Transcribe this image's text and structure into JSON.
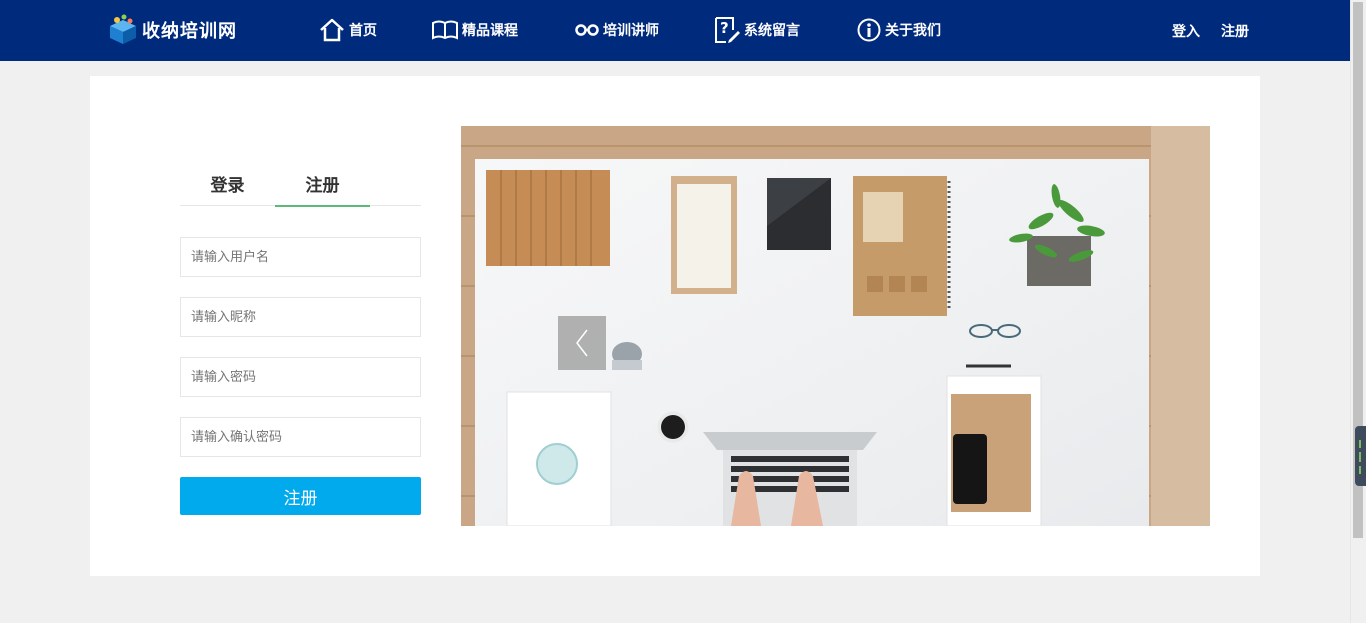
{
  "brand": {
    "name": "收纳培训网"
  },
  "nav": {
    "items": [
      {
        "label": "首页",
        "icon": "home-icon"
      },
      {
        "label": "精品课程",
        "icon": "book-icon"
      },
      {
        "label": "培训讲师",
        "icon": "glasses-icon"
      },
      {
        "label": "系统留言",
        "icon": "question-doc-icon"
      },
      {
        "label": "关于我们",
        "icon": "info-icon"
      }
    ],
    "login": "登入",
    "register": "注册"
  },
  "form": {
    "tabs": {
      "login": "登录",
      "register": "注册",
      "active": "register"
    },
    "username_placeholder": "请输入用户名",
    "nickname_placeholder": "请输入昵称",
    "password_placeholder": "请输入密码",
    "confirm_placeholder": "请输入确认密码",
    "submit_label": "注册"
  },
  "colors": {
    "header_bg": "#002a7c",
    "submit_bg": "#01aaed",
    "active_tab_underline": "#5fb878"
  }
}
